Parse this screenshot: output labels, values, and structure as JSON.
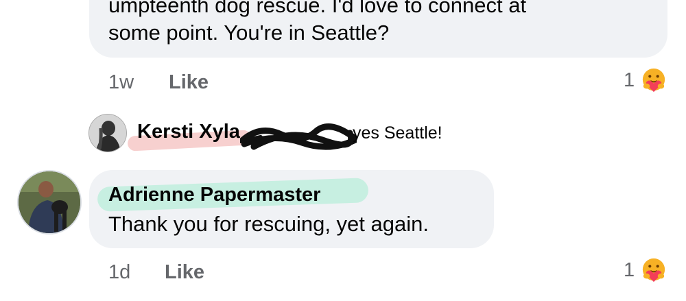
{
  "comment1": {
    "line1": "umpteenth dog rescue.  I'd love to connect at",
    "line2": "some point.  You're in Seattle?",
    "time": "1w",
    "like_label": "Like",
    "reaction_count": "1"
  },
  "reply": {
    "author": "Kersti Xyla",
    "text": "yes Seattle!"
  },
  "comment2": {
    "author": "Adrienne Papermaster",
    "text": "Thank you for rescuing, yet again.",
    "time": "1d",
    "like_label": "Like",
    "reaction_count": "1"
  },
  "reaction_icon": "care-hug-emoji-icon",
  "colors": {
    "bubble": "#f0f2f5",
    "meta_text": "#65676b",
    "green_highlight": "#bfeedd",
    "pink_highlight": "#f6c8c7",
    "emoji_face": "#f7b125",
    "emoji_heart": "#f33e58"
  }
}
